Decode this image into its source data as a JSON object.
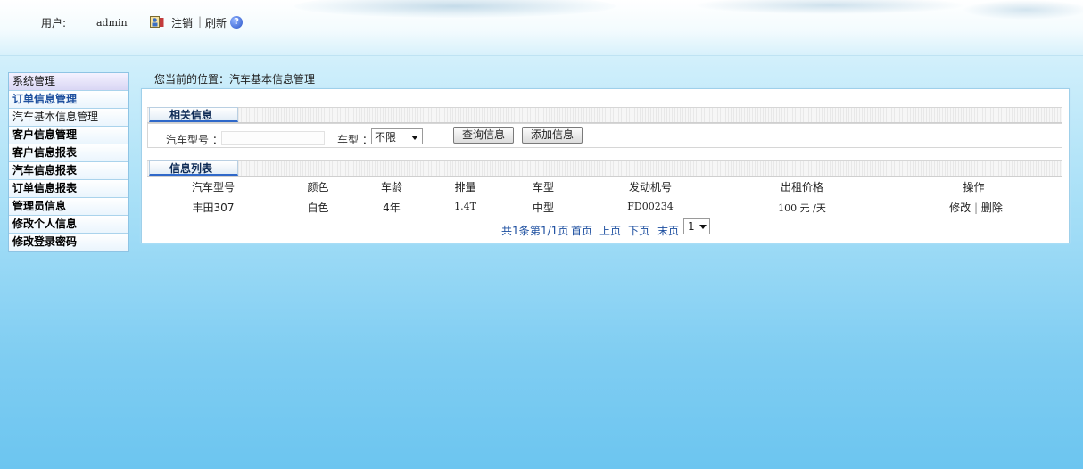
{
  "header": {
    "user_label": "用户:",
    "user_name": "admin",
    "logout_label": "注销",
    "separator": "|",
    "refresh_label": "刷新",
    "help_symbol": "?"
  },
  "sidebar": {
    "items": [
      {
        "label": "系统管理"
      },
      {
        "label": "订单信息管理"
      },
      {
        "label": "汽车基本信息管理"
      },
      {
        "label": "客户信息管理"
      },
      {
        "label": "客户信息报表"
      },
      {
        "label": "汽车信息报表"
      },
      {
        "label": "订单信息报表"
      },
      {
        "label": "管理员信息"
      },
      {
        "label": "修改个人信息"
      },
      {
        "label": "修改登录密码"
      }
    ]
  },
  "breadcrumb": "您当前的位置：汽车基本信息管理",
  "search": {
    "section_title": "相关信息",
    "model_label": "汽车型号 ：",
    "model_value": "",
    "type_label": "车型 ：",
    "type_selected": "不限",
    "query_button": "查询信息",
    "add_button": "添加信息"
  },
  "list": {
    "section_title": "信息列表",
    "columns": [
      "汽车型号",
      "颜色",
      "车龄",
      "排量",
      "车型",
      "发动机号",
      "出租价格",
      "操作"
    ],
    "rows": [
      {
        "model": "丰田307",
        "color": "白色",
        "age": "4年",
        "displacement": "1.4T",
        "type": "中型",
        "engine": "FD00234",
        "price": "100 元 /天",
        "edit": "修改",
        "sep": "|",
        "delete": "删除"
      }
    ]
  },
  "pager": {
    "total": "共1条",
    "page_info": "第1/1页",
    "first": "首页",
    "prev": "上页",
    "next": "下页",
    "last": "末页",
    "page_selected": "1"
  },
  "colors": {
    "accent_blue": "#2f68c9",
    "link_blue": "#1d4fa0",
    "border_blue": "#9fd0ea"
  }
}
